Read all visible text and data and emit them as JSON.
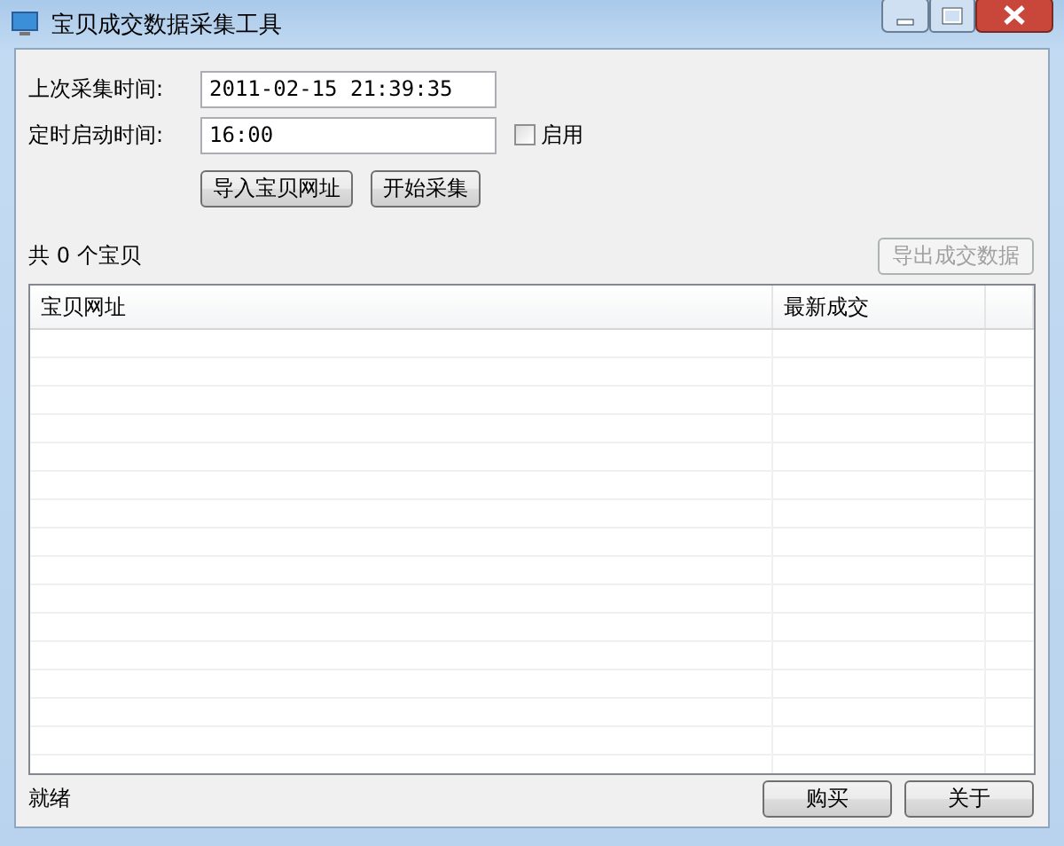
{
  "window": {
    "title": "宝贝成交数据采集工具"
  },
  "form": {
    "fields": [
      {
        "label": "上次采集时间:",
        "value": "2011-02-15 21:39:35"
      },
      {
        "label": "定时启动时间:",
        "value": "16:00"
      }
    ],
    "enable_checkbox": {
      "label": "启用",
      "checked": false
    },
    "buttons": [
      {
        "label": "导入宝贝网址",
        "disabled": false
      },
      {
        "label": "开始采集",
        "disabled": false
      }
    ]
  },
  "count_label": "共 0 个宝贝",
  "export_button": {
    "label": "导出成交数据",
    "disabled": true
  },
  "table": {
    "columns": [
      "宝贝网址",
      "最新成交"
    ]
  },
  "status_bar": {
    "text": "就绪"
  },
  "footer_buttons": [
    {
      "label": "购买",
      "disabled": false
    },
    {
      "label": "关于",
      "disabled": false
    }
  ]
}
